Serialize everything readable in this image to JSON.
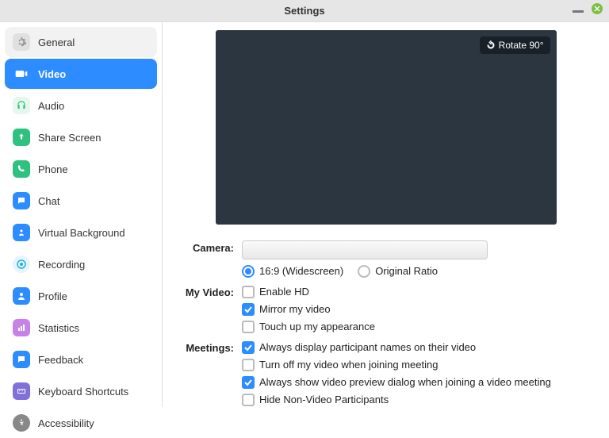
{
  "window": {
    "title": "Settings"
  },
  "sidebar": {
    "items": [
      {
        "label": "General"
      },
      {
        "label": "Video"
      },
      {
        "label": "Audio"
      },
      {
        "label": "Share Screen"
      },
      {
        "label": "Phone"
      },
      {
        "label": "Chat"
      },
      {
        "label": "Virtual Background"
      },
      {
        "label": "Recording"
      },
      {
        "label": "Profile"
      },
      {
        "label": "Statistics"
      },
      {
        "label": "Feedback"
      },
      {
        "label": "Keyboard Shortcuts"
      },
      {
        "label": "Accessibility"
      }
    ]
  },
  "preview": {
    "rotate": "Rotate 90°"
  },
  "form": {
    "camera_label": "Camera:",
    "camera_value": "",
    "myvideo_label": "My Video:",
    "meetings_label": "Meetings:",
    "ratio_169": "16:9 (Widescreen)",
    "ratio_orig": "Original Ratio",
    "enable_hd": "Enable HD",
    "mirror": "Mirror my video",
    "touchup": "Touch up my appearance",
    "participant_names": "Always display participant names on their video",
    "turnoff_video": "Turn off my video when joining meeting",
    "show_preview": "Always show video preview dialog when joining a video meeting",
    "hide_nonvideo": "Hide Non-Video Participants"
  }
}
